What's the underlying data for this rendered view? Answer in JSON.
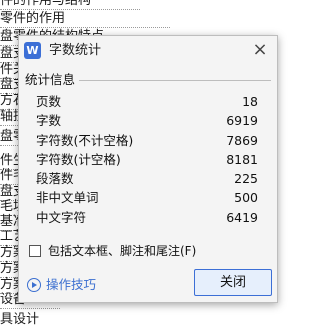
{
  "document": {
    "lines": [
      "件的作用与结构",
      "零件的作用",
      "盘零件的结构特点",
      "盘支",
      "件关",
      "盘支",
      "方石",
      "轴技",
      "盘零",
      "件生",
      "件毛",
      "盘支",
      "毛坯",
      "基准",
      "工艺路线",
      "方案",
      "方案",
      "方案",
      "设备",
      "具设计"
    ]
  },
  "dialog": {
    "title": "字数统计",
    "app_icon": "W",
    "close_icon": "close-icon",
    "section_title": "统计信息",
    "stats": [
      {
        "label": "页数",
        "value": "18"
      },
      {
        "label": "字数",
        "value": "6919"
      },
      {
        "label": "字符数(不计空格)",
        "value": "7869"
      },
      {
        "label": "字符数(计空格)",
        "value": "8181"
      },
      {
        "label": "段落数",
        "value": "225"
      },
      {
        "label": "非中文单词",
        "value": "500"
      },
      {
        "label": "中文字符",
        "value": "6419"
      }
    ],
    "include_option": {
      "label": "包括文本框、脚注和尾注(F)",
      "checked": false
    },
    "tips_label": "操作技巧",
    "close_button": "关闭",
    "accent_color": "#3c6fd6"
  }
}
